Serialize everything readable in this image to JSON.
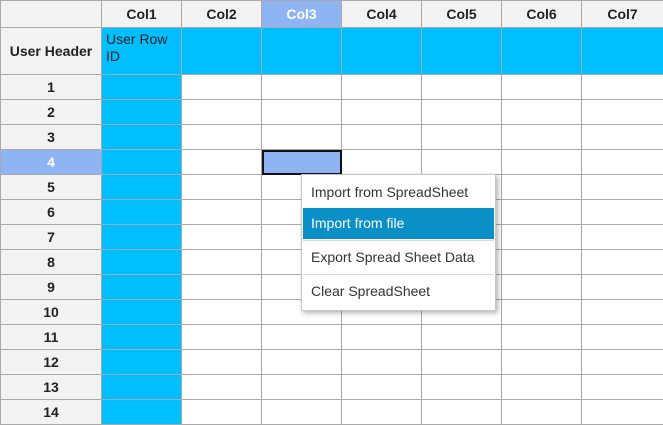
{
  "columns": [
    "Col1",
    "Col2",
    "Col3",
    "Col4",
    "Col5",
    "Col6",
    "Col7"
  ],
  "selected_column": "Col3",
  "user_header": "User Header",
  "user_row_label": "User Row ID",
  "rows": [
    "1",
    "2",
    "3",
    "4",
    "5",
    "6",
    "7",
    "8",
    "9",
    "10",
    "11",
    "12",
    "13",
    "14"
  ],
  "selected_row": "4",
  "context_menu": {
    "import_spreadsheet": "Import from SpreadSheet",
    "import_file": "Import from file",
    "export": "Export Spread Sheet Data",
    "clear": "Clear SpreadSheet"
  },
  "colors": {
    "user_row_bg": "#00bfff",
    "selection": "#8eb4f3",
    "menu_highlight": "#0a8fc6"
  }
}
